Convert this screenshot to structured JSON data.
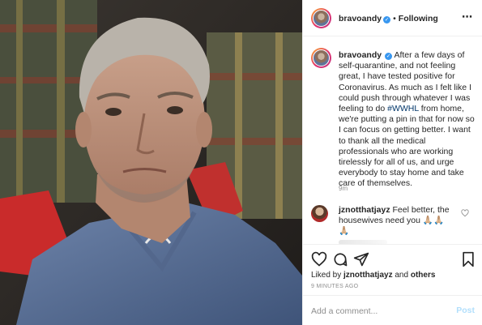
{
  "post": {
    "username": "bravoandy",
    "follow_status": "Following",
    "more_icon": "more-options-icon",
    "caption_body": "After a few days of self-quarantine, and not feeling great, I have tested positive for Coronavirus.  As much as I felt like I could push through whatever I was feeling to do",
    "caption_hashtag": "#WWHL",
    "caption_rest": "from home, we're putting a pin in that for now so I can focus on getting better.  I want to thank all the medical professionals who are working tirelessly for all of us, and urge everybody to stay home and take care of themselves.",
    "caption_time": "9m",
    "photo_description_icon": "selfie-photo"
  },
  "comment": {
    "username": "jznotthatjayz",
    "text": "Feel better, the housewives need you 🙏🏼🙏🏼🙏🏼",
    "heart_icon": "heart-outline-icon"
  },
  "actions": {
    "like_icon": "heart-icon",
    "comment_icon": "comment-icon",
    "share_icon": "share-icon",
    "save_icon": "bookmark-icon",
    "liked_by_prefix": "Liked by",
    "liked_by_user": "jznotthatjayz",
    "liked_by_suffix": "and",
    "liked_by_others": "others",
    "time_ago": "9 MINUTES AGO"
  },
  "composer": {
    "placeholder": "Add a comment...",
    "post_label": "Post"
  },
  "colors": {
    "accent_blue": "#3897f0",
    "hashtag": "#003569",
    "muted": "#8e8e8e",
    "post_disabled": "#b2dffc"
  }
}
